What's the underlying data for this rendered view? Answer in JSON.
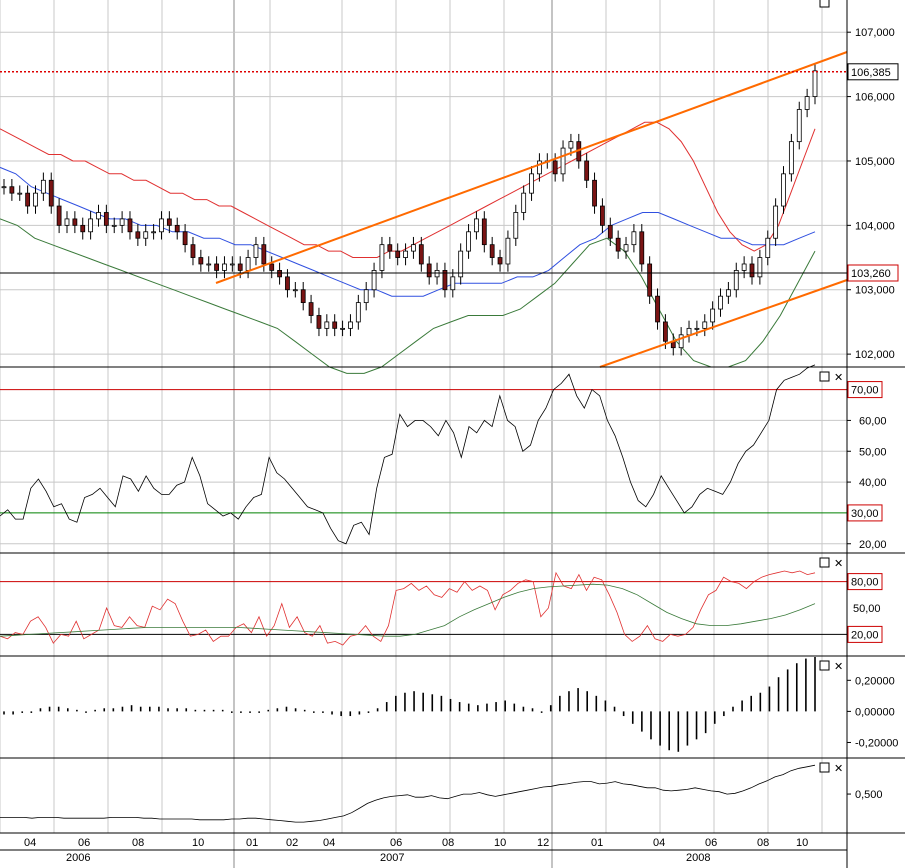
{
  "colors": {
    "background": "#ffffff",
    "grid": "#c8c8c8",
    "candle_up": "#ffffff",
    "candle_down": "#7a1414",
    "ma_red": "#e03030",
    "ma_blue": "#3050e0",
    "ma_green": "#3a7a3a",
    "trendline": "#ff6a00",
    "hline_red": "#cc0000",
    "hline_green": "#008000",
    "price_dotted": "#dd0000"
  },
  "chart_data": [
    {
      "type": "candlestick",
      "panel": "price",
      "yticks": [
        "107,000",
        "106,000",
        "105,000",
        "104,000",
        "103,000",
        "102,000"
      ],
      "ylim": [
        101.8,
        107.5
      ],
      "price_label": "106,385",
      "hline_label": "103,260",
      "close": [
        104.6,
        104.5,
        104.5,
        104.3,
        104.5,
        104.7,
        104.3,
        104.0,
        104.1,
        104.0,
        103.9,
        104.1,
        104.2,
        104.0,
        104.0,
        104.1,
        103.9,
        103.8,
        103.9,
        103.9,
        104.1,
        104.0,
        103.9,
        103.7,
        103.5,
        103.4,
        103.4,
        103.3,
        103.4,
        103.4,
        103.3,
        103.5,
        103.7,
        103.4,
        103.3,
        103.2,
        103.0,
        103.0,
        102.8,
        102.6,
        102.4,
        102.5,
        102.4,
        102.4,
        102.5,
        102.8,
        103.0,
        103.3,
        103.7,
        103.6,
        103.5,
        103.6,
        103.7,
        103.4,
        103.2,
        103.3,
        103.0,
        103.2,
        103.6,
        103.9,
        104.1,
        103.7,
        103.5,
        103.4,
        103.8,
        104.2,
        104.5,
        104.8,
        105.0,
        105.0,
        104.8,
        105.2,
        105.3,
        105.0,
        104.7,
        104.3,
        104.0,
        103.8,
        103.6,
        103.7,
        103.9,
        103.4,
        102.9,
        102.5,
        102.2,
        102.1,
        102.3,
        102.4,
        102.4,
        102.5,
        102.7,
        102.9,
        103.0,
        103.3,
        103.4,
        103.2,
        103.5,
        103.8,
        104.3,
        104.8,
        105.3,
        105.8,
        106.0,
        106.4
      ],
      "ma_red": [
        105.5,
        105.4,
        105.3,
        105.2,
        105.1,
        105.1,
        105.0,
        105.0,
        104.9,
        104.8,
        104.8,
        104.7,
        104.7,
        104.6,
        104.5,
        104.5,
        104.4,
        104.4,
        104.3,
        104.3,
        104.2,
        104.1,
        104.0,
        103.9,
        103.8,
        103.7,
        103.7,
        103.6,
        103.6,
        103.5,
        103.5,
        103.5,
        103.6,
        103.6,
        103.7,
        103.8,
        103.9,
        104.0,
        104.1,
        104.2,
        104.3,
        104.4,
        104.5,
        104.6,
        104.7,
        104.8,
        104.9,
        105.0,
        105.1,
        105.2,
        105.3,
        105.4,
        105.5,
        105.6,
        105.6,
        105.5,
        105.3,
        105.0,
        104.6,
        104.2,
        103.9,
        103.7,
        103.6,
        103.7,
        104.0,
        104.5,
        105.0,
        105.5
      ],
      "ma_blue": [
        104.9,
        104.8,
        104.6,
        104.5,
        104.4,
        104.3,
        104.2,
        104.1,
        104.1,
        104.0,
        104.0,
        103.9,
        103.9,
        103.8,
        103.8,
        103.7,
        103.7,
        103.6,
        103.5,
        103.4,
        103.3,
        103.2,
        103.1,
        103.0,
        103.0,
        102.9,
        102.9,
        102.9,
        103.0,
        103.1,
        103.1,
        103.1,
        103.1,
        103.2,
        103.2,
        103.3,
        103.5,
        103.7,
        103.8,
        104.0,
        104.1,
        104.2,
        104.2,
        104.1,
        104.0,
        103.9,
        103.8,
        103.8,
        103.7,
        103.7,
        103.7,
        103.8,
        103.9
      ],
      "ma_green": [
        104.1,
        104.0,
        103.8,
        103.7,
        103.6,
        103.5,
        103.4,
        103.3,
        103.2,
        103.1,
        103.0,
        102.9,
        102.8,
        102.7,
        102.6,
        102.5,
        102.4,
        102.2,
        102.0,
        101.8,
        101.7,
        101.7,
        101.8,
        102.0,
        102.2,
        102.4,
        102.5,
        102.6,
        102.6,
        102.6,
        102.7,
        102.9,
        103.1,
        103.4,
        103.7,
        103.8,
        103.6,
        103.2,
        102.7,
        102.2,
        101.9,
        101.8,
        101.8,
        101.9,
        102.2,
        102.6,
        103.1,
        103.6
      ]
    },
    {
      "type": "line",
      "panel": "rsi",
      "yticks": [
        "60,00",
        "50,00",
        "40,00",
        "30,00",
        "20,00"
      ],
      "ylim": [
        17,
        77
      ],
      "upper_label": "70,00",
      "lower_label": "30,00",
      "values": [
        29,
        31,
        28,
        28,
        38,
        41,
        37,
        32,
        33,
        28,
        27,
        35,
        36,
        38,
        35,
        32,
        42,
        41,
        37,
        42,
        38,
        36,
        36,
        39,
        40,
        48,
        42,
        33,
        31,
        29,
        30,
        28,
        32,
        35,
        36,
        48,
        43,
        41,
        38,
        35,
        32,
        31,
        30,
        25,
        21,
        20,
        26,
        27,
        23,
        38,
        48,
        49,
        62,
        58,
        60,
        60,
        58,
        55,
        60,
        56,
        48,
        58,
        56,
        60,
        58,
        68,
        60,
        58,
        50,
        52,
        60,
        64,
        70,
        72,
        75,
        68,
        64,
        70,
        68,
        60,
        55,
        48,
        40,
        34,
        32,
        36,
        42,
        38,
        34,
        30,
        32,
        36,
        38,
        37,
        36,
        40,
        46,
        50,
        52,
        56,
        60,
        70,
        73,
        74,
        75,
        77,
        78
      ]
    },
    {
      "type": "line",
      "panel": "stochastic",
      "yticks": [
        "80,00",
        "50,00",
        "20,00"
      ],
      "ylim": [
        0,
        100
      ],
      "upper_label": "80,00",
      "lower_label": "20,00",
      "k_values": [
        18,
        15,
        22,
        20,
        35,
        40,
        28,
        10,
        20,
        18,
        35,
        15,
        20,
        25,
        50,
        30,
        28,
        40,
        30,
        28,
        52,
        48,
        60,
        55,
        35,
        18,
        20,
        25,
        12,
        18,
        18,
        28,
        32,
        22,
        40,
        18,
        30,
        55,
        28,
        40,
        22,
        18,
        30,
        10,
        12,
        8,
        18,
        20,
        30,
        18,
        12,
        30,
        70,
        72,
        78,
        70,
        75,
        65,
        62,
        72,
        68,
        80,
        70,
        75,
        70,
        48,
        65,
        70,
        78,
        82,
        80,
        40,
        50,
        90,
        75,
        72,
        88,
        70,
        85,
        82,
        65,
        45,
        20,
        12,
        18,
        30,
        15,
        12,
        20,
        18,
        20,
        28,
        48,
        65,
        70,
        85,
        80,
        78,
        72,
        80,
        85,
        88,
        90,
        92,
        90,
        92,
        88,
        90
      ],
      "d_values": [
        18,
        19,
        20,
        21,
        22,
        23,
        24,
        25,
        26,
        27,
        28,
        28,
        28,
        28,
        28,
        28,
        28,
        27,
        26,
        25,
        24,
        23,
        22,
        21,
        20,
        19,
        18,
        18,
        20,
        25,
        30,
        40,
        48,
        55,
        62,
        68,
        72,
        74,
        75,
        76,
        77,
        76,
        72,
        65,
        55,
        45,
        38,
        32,
        30,
        30,
        32,
        35,
        38,
        42,
        48,
        55
      ]
    },
    {
      "type": "bar",
      "panel": "momentum",
      "yticks": [
        "0,20000",
        "0,00000",
        "-0,20000"
      ],
      "ylim": [
        -0.3,
        0.35
      ],
      "values": [
        -0.02,
        -0.02,
        -0.01,
        -0.01,
        0.02,
        0.03,
        0.03,
        0.02,
        0.01,
        0.0,
        0.01,
        0.02,
        0.02,
        0.03,
        0.04,
        0.03,
        0.03,
        0.03,
        0.02,
        0.02,
        0.02,
        0.01,
        0.01,
        0.01,
        0.01,
        -0.01,
        -0.01,
        -0.01,
        0.0,
        0.01,
        0.02,
        0.03,
        0.02,
        0.01,
        0.0,
        -0.01,
        -0.02,
        -0.03,
        -0.03,
        -0.02,
        -0.01,
        0.02,
        0.06,
        0.1,
        0.12,
        0.13,
        0.12,
        0.11,
        0.1,
        0.08,
        0.06,
        0.05,
        0.04,
        0.05,
        0.06,
        0.07,
        0.05,
        0.03,
        0.02,
        0.0,
        0.04,
        0.1,
        0.13,
        0.15,
        0.13,
        0.1,
        0.07,
        0.03,
        -0.03,
        -0.08,
        -0.13,
        -0.18,
        -0.22,
        -0.25,
        -0.26,
        -0.22,
        -0.18,
        -0.14,
        -0.08,
        -0.03,
        0.03,
        0.07,
        0.1,
        0.12,
        0.16,
        0.22,
        0.27,
        0.31,
        0.34,
        0.35
      ]
    },
    {
      "type": "line",
      "panel": "cumulative",
      "yticks": [
        "0,500"
      ],
      "ylim": [
        0,
        0.95
      ],
      "values": [
        0.2,
        0.2,
        0.2,
        0.2,
        0.19,
        0.2,
        0.2,
        0.2,
        0.19,
        0.19,
        0.19,
        0.19,
        0.19,
        0.19,
        0.2,
        0.2,
        0.2,
        0.2,
        0.19,
        0.19,
        0.18,
        0.18,
        0.18,
        0.18,
        0.18,
        0.17,
        0.17,
        0.17,
        0.17,
        0.18,
        0.18,
        0.19,
        0.19,
        0.18,
        0.17,
        0.16,
        0.15,
        0.14,
        0.14,
        0.15,
        0.16,
        0.18,
        0.2,
        0.22,
        0.26,
        0.32,
        0.38,
        0.42,
        0.45,
        0.47,
        0.48,
        0.49,
        0.46,
        0.46,
        0.48,
        0.45,
        0.44,
        0.47,
        0.5,
        0.5,
        0.52,
        0.49,
        0.47,
        0.49,
        0.51,
        0.53,
        0.55,
        0.57,
        0.59,
        0.6,
        0.62,
        0.63,
        0.65,
        0.66,
        0.66,
        0.63,
        0.64,
        0.66,
        0.63,
        0.62,
        0.6,
        0.58,
        0.58,
        0.55,
        0.54,
        0.55,
        0.56,
        0.58,
        0.56,
        0.54,
        0.53,
        0.5,
        0.51,
        0.54,
        0.58,
        0.63,
        0.67,
        0.72,
        0.75,
        0.8,
        0.83,
        0.85,
        0.87
      ]
    }
  ],
  "x_axis": {
    "months": [
      "04",
      "06",
      "08",
      "10",
      "01",
      "02",
      "04",
      "06",
      "08",
      "10",
      "12",
      "01",
      "04",
      "06",
      "08",
      "10"
    ],
    "years": [
      "2006",
      "2007",
      "2008"
    ]
  }
}
